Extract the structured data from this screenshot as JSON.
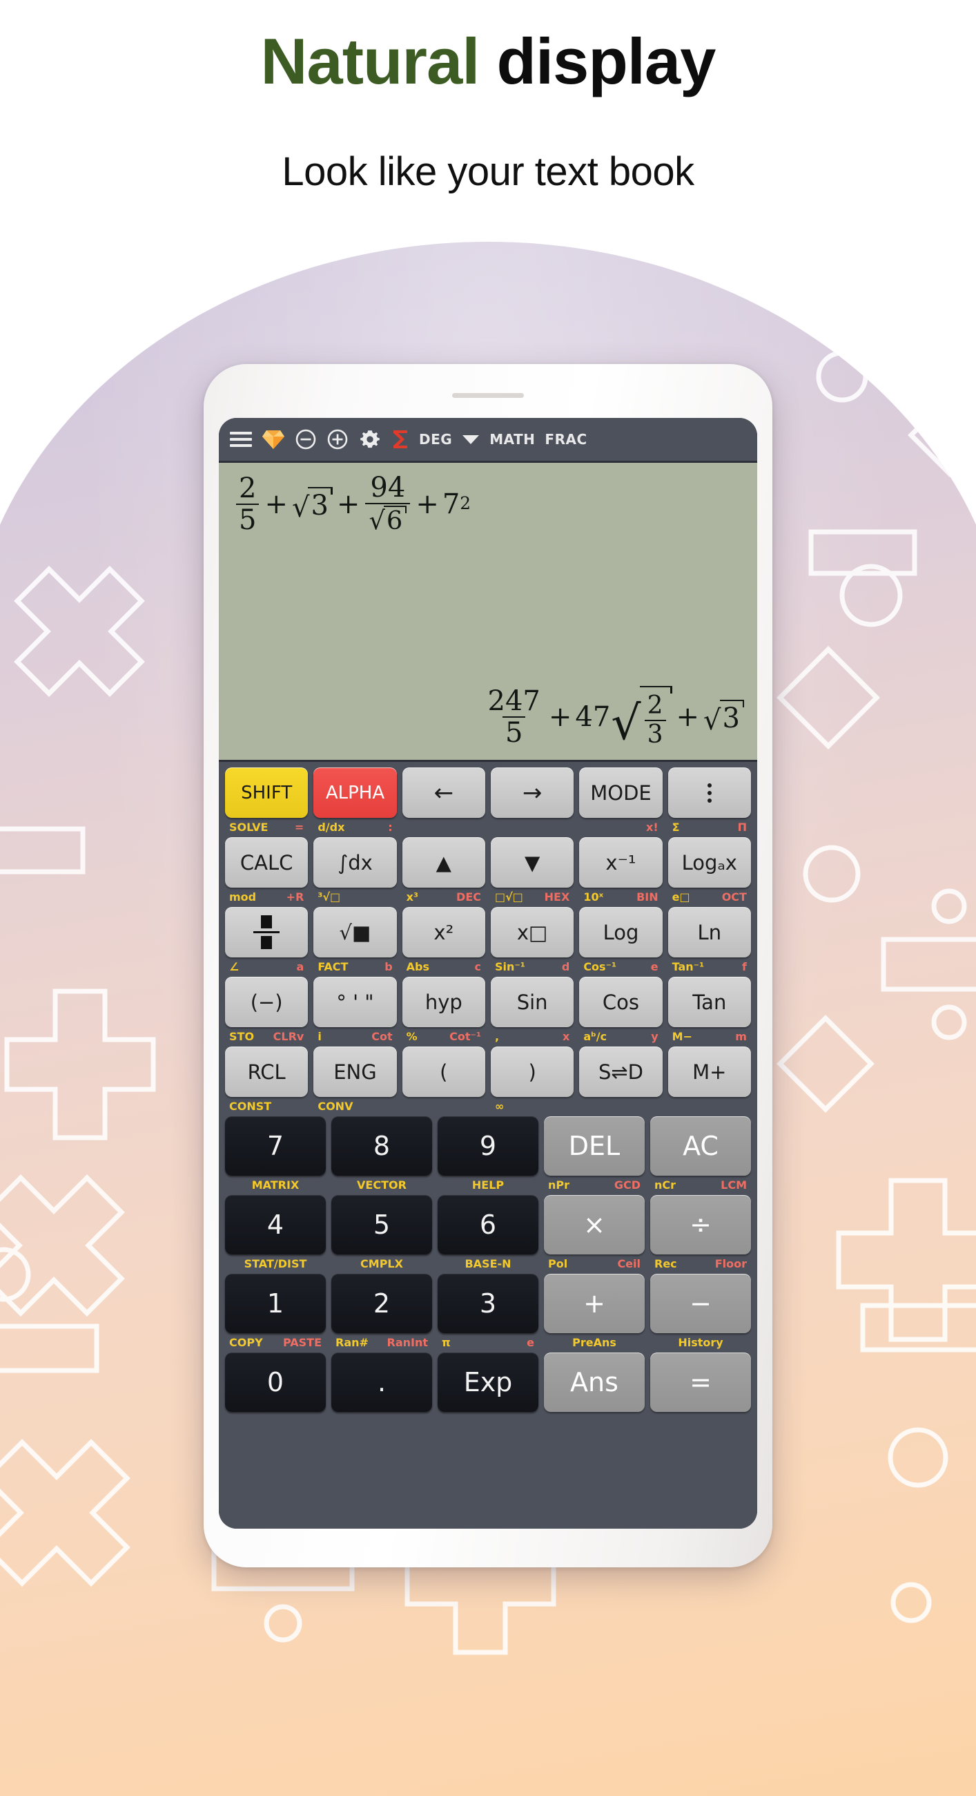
{
  "headline": {
    "part1": "Natural",
    "part2": " display",
    "color_green": "#3c5c24",
    "color_black": "#0d0d0d"
  },
  "subheadline": "Look like your text book",
  "app": {
    "toolbar": {
      "menu_icon": "hamburger-menu-icon",
      "premium_icon": "diamond-icon",
      "zoom_out_icon": "minus-circle-icon",
      "zoom_in_icon": "plus-circle-icon",
      "settings_icon": "gear-icon",
      "sigma_icon": "sigma-icon",
      "angle_mode": "DEG",
      "dropdown_icon": "chevron-down-icon",
      "mode_math": "MATH",
      "mode_frac": "FRAC"
    },
    "display": {
      "background_color": "#adb5a0",
      "expression": {
        "frac1": {
          "num": "2",
          "den": "5"
        },
        "op1": "+",
        "sqrt1": "3",
        "op2": "+",
        "frac2": {
          "num": "94",
          "den_sqrt": "6"
        },
        "op3": "+",
        "pow": {
          "base": "7",
          "exp": "2"
        }
      },
      "result": {
        "frac1": {
          "num": "247",
          "den": "5"
        },
        "op1": "+",
        "coef": "47",
        "sqrt_frac": {
          "num": "2",
          "den": "3"
        },
        "op2": "+",
        "sqrt1": "3"
      }
    },
    "keypad": {
      "rows": [
        {
          "keys": [
            {
              "label": "SHIFT",
              "style": "shift"
            },
            {
              "label": "ALPHA",
              "style": "alpha"
            },
            {
              "label": "←",
              "style": "arrow",
              "name": "left-arrow-key"
            },
            {
              "label": "→",
              "style": "arrow",
              "name": "right-arrow-key"
            },
            {
              "label": "MODE",
              "style": "plain"
            },
            {
              "label": "",
              "style": "dots",
              "name": "overflow-menu-key"
            }
          ],
          "labels": [
            {
              "left": "SOLVE",
              "right": "="
            },
            {
              "left": "d/dx",
              "right": ":"
            },
            {
              "left": "",
              "right": ""
            },
            {
              "left": "",
              "right": ""
            },
            {
              "left": "",
              "right": "x!"
            },
            {
              "left": "Σ",
              "right": "Π"
            }
          ]
        },
        {
          "keys": [
            {
              "label": "CALC",
              "style": "plain"
            },
            {
              "label": "∫dx",
              "style": "plain"
            },
            {
              "label": "▲",
              "style": "plain",
              "name": "up-arrow-key"
            },
            {
              "label": "▼",
              "style": "plain",
              "name": "down-arrow-key"
            },
            {
              "label": "x⁻¹",
              "style": "plain"
            },
            {
              "label": "Logₐx",
              "style": "plain"
            }
          ],
          "labels": [
            {
              "left": "mod",
              "right": "+R"
            },
            {
              "left": "³√□",
              "right": ""
            },
            {
              "left": "x³",
              "right": "DEC"
            },
            {
              "left": "□√□",
              "right": "HEX"
            },
            {
              "left": "10ˣ",
              "right": "BIN"
            },
            {
              "left": "e□",
              "right": "OCT"
            }
          ]
        },
        {
          "keys": [
            {
              "label": "",
              "style": "fracicon",
              "name": "fraction-key"
            },
            {
              "label": "√■",
              "style": "plain",
              "name": "square-root-key"
            },
            {
              "label": "x²",
              "style": "plain"
            },
            {
              "label": "x□",
              "style": "plain"
            },
            {
              "label": "Log",
              "style": "plain"
            },
            {
              "label": "Ln",
              "style": "plain"
            }
          ],
          "labels": [
            {
              "left": "∠",
              "right": "a"
            },
            {
              "left": "FACT",
              "right": "b"
            },
            {
              "left": "Abs",
              "right": "c"
            },
            {
              "left": "Sin⁻¹",
              "right": "d"
            },
            {
              "left": "Cos⁻¹",
              "right": "e"
            },
            {
              "left": "Tan⁻¹",
              "right": "f"
            }
          ]
        },
        {
          "keys": [
            {
              "label": "(−)",
              "style": "plain"
            },
            {
              "label": "° ' \"",
              "style": "plain"
            },
            {
              "label": "hyp",
              "style": "plain"
            },
            {
              "label": "Sin",
              "style": "plain"
            },
            {
              "label": "Cos",
              "style": "plain"
            },
            {
              "label": "Tan",
              "style": "plain"
            }
          ],
          "labels": [
            {
              "left": "STO",
              "right": "CLRv"
            },
            {
              "left": "i",
              "right": "Cot"
            },
            {
              "left": "%",
              "right": "Cot⁻¹"
            },
            {
              "left": ",",
              "right": "x"
            },
            {
              "left": "aᵇ/c",
              "right": "y"
            },
            {
              "left": "M−",
              "right": "m"
            }
          ]
        },
        {
          "keys": [
            {
              "label": "RCL",
              "style": "plain"
            },
            {
              "label": "ENG",
              "style": "plain"
            },
            {
              "label": "(",
              "style": "plain"
            },
            {
              "label": ")",
              "style": "plain"
            },
            {
              "label": "S⇌D",
              "style": "plain"
            },
            {
              "label": "M+",
              "style": "plain"
            }
          ],
          "labels": [
            {
              "left": "CONST",
              "right": ""
            },
            {
              "left": "CONV",
              "right": ""
            },
            {
              "left": "",
              "right": ""
            },
            {
              "left": "∞",
              "right": ""
            },
            {
              "left": "",
              "right": ""
            },
            {
              "left": "",
              "right": ""
            }
          ]
        },
        {
          "keys": [
            {
              "label": "7",
              "style": "dark"
            },
            {
              "label": "8",
              "style": "dark"
            },
            {
              "label": "9",
              "style": "dark"
            },
            {
              "label": "DEL",
              "style": "midgray"
            },
            {
              "label": "AC",
              "style": "midgray"
            }
          ],
          "labels": [
            {
              "center": "MATRIX"
            },
            {
              "center": "VECTOR"
            },
            {
              "center": "HELP"
            },
            {
              "left": "nPr",
              "right": "GCD"
            },
            {
              "left": "nCr",
              "right": "LCM"
            }
          ]
        },
        {
          "keys": [
            {
              "label": "4",
              "style": "dark"
            },
            {
              "label": "5",
              "style": "dark"
            },
            {
              "label": "6",
              "style": "dark"
            },
            {
              "label": "×",
              "style": "midgray"
            },
            {
              "label": "÷",
              "style": "midgray"
            }
          ],
          "labels": [
            {
              "center": "STAT/DIST"
            },
            {
              "center": "CMPLX"
            },
            {
              "center": "BASE-N"
            },
            {
              "left": "Pol",
              "right": "Ceil"
            },
            {
              "left": "Rec",
              "right": "Floor"
            }
          ]
        },
        {
          "keys": [
            {
              "label": "1",
              "style": "dark"
            },
            {
              "label": "2",
              "style": "dark"
            },
            {
              "label": "3",
              "style": "dark"
            },
            {
              "label": "+",
              "style": "midgray"
            },
            {
              "label": "−",
              "style": "midgray"
            }
          ],
          "labels": [
            {
              "left": "COPY",
              "right": "PASTE"
            },
            {
              "left": "Ran#",
              "right": "RanInt"
            },
            {
              "left": "π",
              "right": "e"
            },
            {
              "center": "PreAns"
            },
            {
              "center": "History"
            }
          ]
        },
        {
          "keys": [
            {
              "label": "0",
              "style": "dark"
            },
            {
              "label": ".",
              "style": "dark"
            },
            {
              "label": "Exp",
              "style": "dark"
            },
            {
              "label": "Ans",
              "style": "midgray"
            },
            {
              "label": "=",
              "style": "midgray"
            }
          ],
          "labels": []
        }
      ]
    }
  }
}
